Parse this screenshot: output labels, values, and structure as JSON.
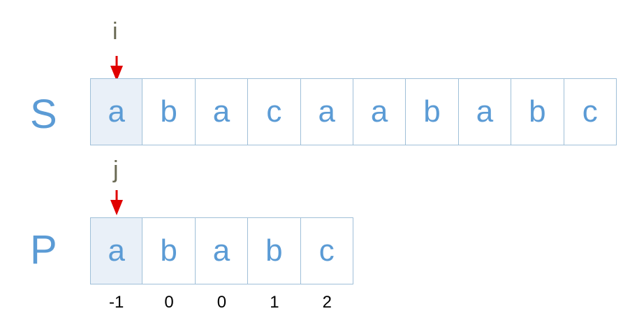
{
  "text_string": {
    "label": "S",
    "chars": [
      "a",
      "b",
      "a",
      "c",
      "a",
      "a",
      "b",
      "a",
      "b",
      "c"
    ]
  },
  "pattern": {
    "label": "P",
    "chars": [
      "a",
      "b",
      "a",
      "b",
      "c"
    ],
    "next": [
      "-1",
      "0",
      "0",
      "1",
      "2"
    ]
  },
  "pointers": {
    "text_pointer": "i",
    "pattern_pointer": "j"
  },
  "colors": {
    "accent": "#5b9bd5",
    "arrow": "#e00000",
    "cell_border": "#9fbfd8",
    "highlight": "#e9f0f8"
  }
}
